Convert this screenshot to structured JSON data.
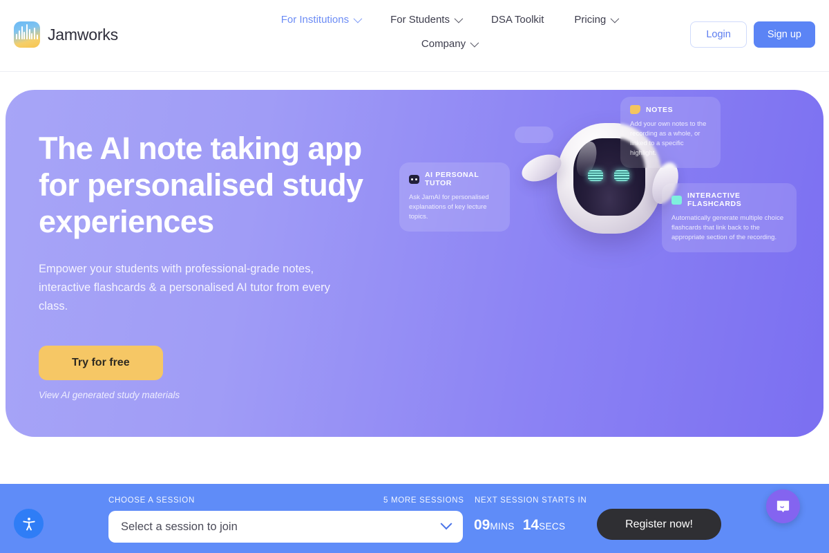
{
  "header": {
    "brand": {
      "name": "Jamworks",
      "logo_icon": "waveform-logo-icon"
    },
    "nav": [
      {
        "label": "For Institutions",
        "has_dropdown": true,
        "active": true
      },
      {
        "label": "For Students",
        "has_dropdown": true,
        "active": false
      },
      {
        "label": "DSA Toolkit",
        "has_dropdown": false,
        "active": false
      },
      {
        "label": "Pricing",
        "has_dropdown": true,
        "active": false
      },
      {
        "label": "Company",
        "has_dropdown": true,
        "active": false
      }
    ],
    "login_label": "Login",
    "signup_label": "Sign up"
  },
  "hero": {
    "title": "The AI note taking app for personalised study experiences",
    "subtitle": "Empower your students with professional-grade notes, interactive flashcards & a personalised AI tutor from every class.",
    "cta_label": "Try for free",
    "link_label": "View AI generated study materials",
    "cards": [
      {
        "title": "NOTES",
        "body": "Add your own notes to the recording as a whole, or linked to a specific highlight.",
        "icon": "sticky-note-icon",
        "icon_color": "#f4c560"
      },
      {
        "title": "AI PERSONAL TUTOR",
        "body": "Ask JamAI for personalised explanations of key lecture topics.",
        "icon": "robot-head-icon",
        "icon_color": "#22203a"
      },
      {
        "title": "INTERACTIVE FLASHCARDS",
        "body": "Automatically generate multiple choice flashcards that link back to the appropriate section of the recording.",
        "icon": "flashcard-icon",
        "icon_color": "#7ef0dd"
      }
    ]
  },
  "session_bar": {
    "choose_label": "CHOOSE A SESSION",
    "more_sessions_label": "5 MORE SESSIONS",
    "next_session_label": "NEXT SESSION STARTS IN",
    "select_value": "Select a session to join",
    "countdown": {
      "minutes": "09",
      "minutes_unit": "MINS",
      "seconds": "14",
      "seconds_unit": "SECS"
    },
    "register_label": "Register now!"
  },
  "widgets": {
    "accessibility_icon": "accessibility-icon",
    "chat_icon": "chat-bubble-icon"
  },
  "colors": {
    "accent_blue": "#5b84f5",
    "hero_purple_left": "#a7a5f7",
    "hero_purple_right": "#7b6ff1",
    "cta_yellow": "#f6c765",
    "session_bar_blue": "#5f8cf8",
    "register_dark": "#2f2f33",
    "intercom_purple": "#8464f0"
  }
}
